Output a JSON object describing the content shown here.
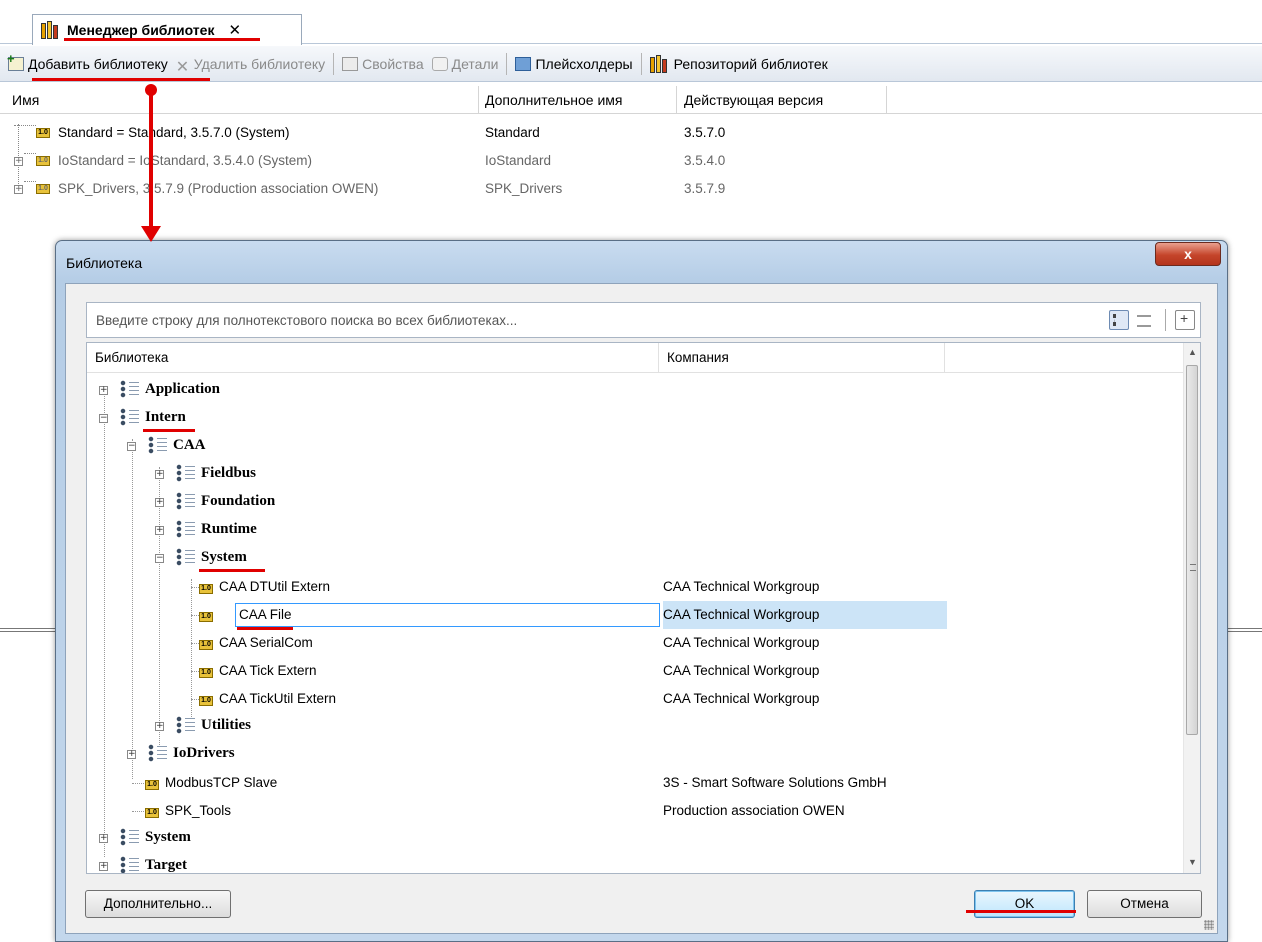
{
  "manager": {
    "tab_label": "Менеджер библиотек",
    "tab_close": "✕",
    "toolbar": {
      "add": "Добавить библиотеку",
      "remove": "Удалить библиотеку",
      "properties": "Свойства",
      "details": "Детали",
      "placeholders": "Плейсхолдеры",
      "repository": "Репозиторий библиотек"
    },
    "columns": {
      "name": "Имя",
      "alt_name": "Дополнительное имя",
      "version": "Действующая версия"
    },
    "rows": [
      {
        "name": "Standard = Standard, 3.5.7.0 (System)",
        "alt": "Standard",
        "version": "3.5.7.0"
      },
      {
        "name": "IoStandard = IoStandard, 3.5.4.0 (System)",
        "alt": "IoStandard",
        "version": "3.5.4.0"
      },
      {
        "name": "SPK_Drivers, 3.5.7.9 (Production association OWEN)",
        "alt": "SPK_Drivers",
        "version": "3.5.7.9"
      }
    ]
  },
  "dialog": {
    "title": "Библиотека",
    "close": "x",
    "search_placeholder": "Введите строку для полнотекстового поиска во всех библиотеках...",
    "col_library": "Библиотека",
    "col_company": "Компания",
    "tree": {
      "application": "Application",
      "intern": "Intern",
      "caa": "CAA",
      "fieldbus": "Fieldbus",
      "foundation": "Foundation",
      "runtime": "Runtime",
      "system_sub": "System",
      "lib1": {
        "name": "CAA DTUtil Extern",
        "company": "CAA Technical Workgroup"
      },
      "lib2": {
        "name": "CAA File",
        "company": "CAA Technical Workgroup"
      },
      "lib3": {
        "name": "CAA SerialCom",
        "company": "CAA Technical Workgroup"
      },
      "lib4": {
        "name": "CAA Tick Extern",
        "company": "CAA Technical Workgroup"
      },
      "lib5": {
        "name": "CAA TickUtil Extern",
        "company": "CAA Technical Workgroup"
      },
      "utilities": "Utilities",
      "iodrivers": "IoDrivers",
      "modbus": {
        "name": "ModbusTCP Slave",
        "company": "3S - Smart Software Solutions GmbH"
      },
      "spk_tools": {
        "name": "SPK_Tools",
        "company": "Production association OWEN"
      },
      "system": "System",
      "target": "Target"
    },
    "lib_icon_text": "1.0",
    "advanced_button": "Дополнительно...",
    "ok_button": "OK",
    "cancel_button": "Отмена"
  },
  "colors": {
    "annotation": "#e00000",
    "selection": "#cce4f7"
  }
}
